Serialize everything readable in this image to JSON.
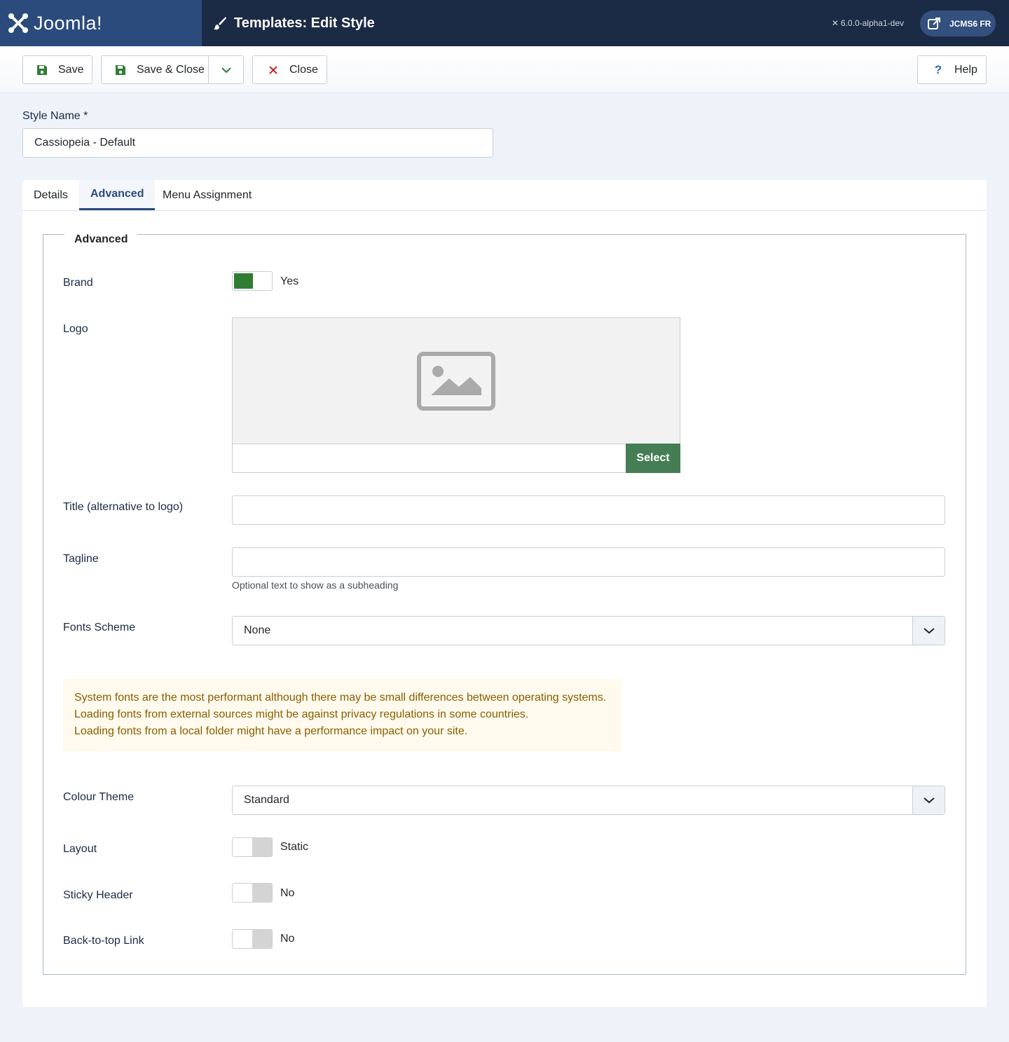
{
  "header": {
    "brand_name": "Joomla!",
    "page_title": "Templates: Edit Style",
    "version": "6.0.0-alpha1-dev",
    "site_button": "JCMS6 FR",
    "colors": {
      "header_bg": "#1c2b45",
      "brand_bg": "#2a4b7b",
      "accent_green": "#2e7d32",
      "select_green": "#457d54"
    }
  },
  "toolbar": {
    "save_label": "Save",
    "save_close_label": "Save & Close",
    "close_label": "Close",
    "help_label": "Help",
    "help_glyph": "?"
  },
  "style_name": {
    "label": "Style Name *",
    "value": "Cassiopeia - Default"
  },
  "tabs": [
    {
      "label": "Details",
      "active": false
    },
    {
      "label": "Advanced",
      "active": true
    },
    {
      "label": "Menu Assignment",
      "active": false
    }
  ],
  "advanced": {
    "legend": "Advanced",
    "brand": {
      "label": "Brand",
      "value": "Yes"
    },
    "logo": {
      "label": "Logo",
      "select_label": "Select",
      "icon": "image-placeholder-icon"
    },
    "title_alt": {
      "label": "Title (alternative to logo)",
      "value": ""
    },
    "tagline": {
      "label": "Tagline",
      "value": "",
      "hint": "Optional text to show as a subheading"
    },
    "fonts_scheme": {
      "label": "Fonts Scheme",
      "value": "None"
    },
    "fonts_alert": [
      "System fonts are the most performant although there may be small differences between operating systems.",
      "Loading fonts from external sources might be against privacy regulations in some countries.",
      "Loading fonts from a local folder might have a performance impact on your site."
    ],
    "colour_theme": {
      "label": "Colour Theme",
      "value": "Standard"
    },
    "layout": {
      "label": "Layout",
      "value": "Static"
    },
    "sticky_header": {
      "label": "Sticky Header",
      "value": "No"
    },
    "back_to_top": {
      "label": "Back-to-top Link",
      "value": "No"
    }
  }
}
